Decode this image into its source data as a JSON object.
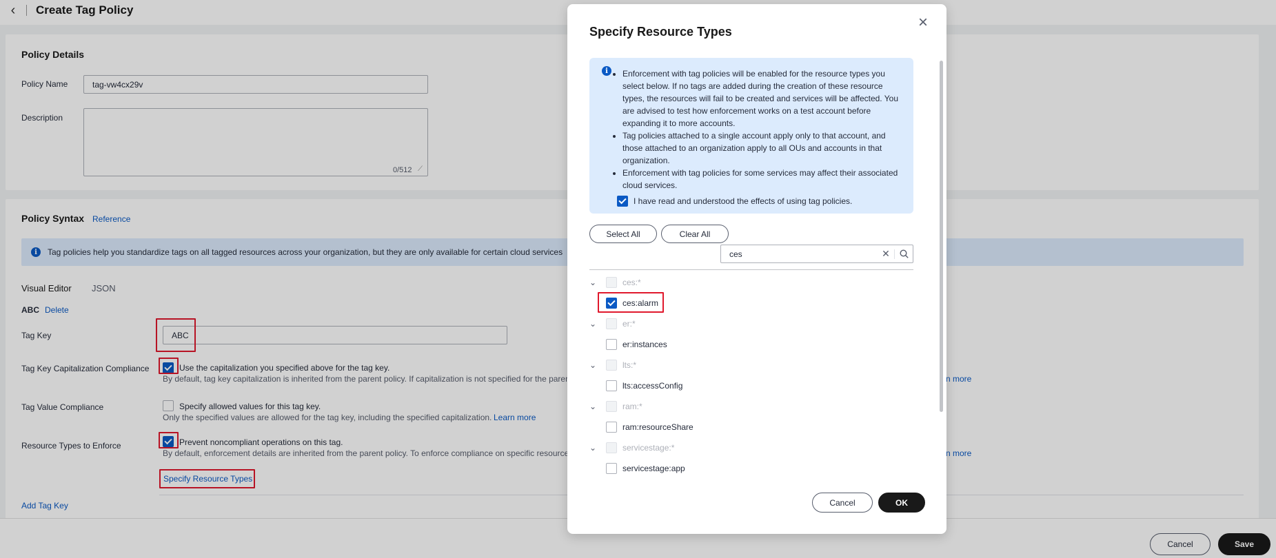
{
  "header": {
    "title": "Create Tag Policy"
  },
  "policy_details": {
    "title": "Policy Details",
    "name_label": "Policy Name",
    "name_value": "tag-vw4cx29v",
    "description_label": "Description",
    "description_counter": "0/512"
  },
  "policy_syntax": {
    "title": "Policy Syntax",
    "reference_link": "Reference",
    "info_text": "Tag policies help you standardize tags on all tagged resources across your organization, but they are only available for certain cloud services",
    "tabs": {
      "visual": "Visual Editor",
      "json": "JSON"
    },
    "tag_block_name": "ABC",
    "delete_link": "Delete",
    "tag_key_label": "Tag Key",
    "tag_key_value": "ABC",
    "cap_label": "Tag Key Capitalization Compliance",
    "cap_checkbox_text": "Use the capitalization you specified above for the tag key.",
    "cap_help": "By default, tag key capitalization is inherited from the parent policy. If capitalization is not specified for the paren",
    "cap_learn_more": "rn more",
    "value_label": "Tag Value Compliance",
    "value_checkbox_text": "Specify allowed values for this tag key.",
    "value_help": "Only the specified values are allowed for the tag key, including the specified capitalization.",
    "value_learn_more": "Learn more",
    "enforce_label": "Resource Types to Enforce",
    "enforce_checkbox_text": "Prevent noncompliant operations on this tag.",
    "enforce_help": "By default, enforcement details are inherited from the parent policy. To enforce compliance on specific resource",
    "enforce_learn_more": "rn more",
    "specify_link": "Specify Resource Types",
    "add_tag_key": "Add Tag Key"
  },
  "footer": {
    "cancel": "Cancel",
    "save": "Save"
  },
  "modal": {
    "title": "Specify Resource Types",
    "close_glyph": "×",
    "notices": [
      "Enforcement with tag policies will be enabled for the resource types you select below. If no tags are added during the creation of these resource types, the resources will fail to be created and services will be affected. You are advised to test how enforcement works on a test account before expanding it to more accounts.",
      "Tag policies attached to a single account apply only to that account, and those attached to an organization apply to all OUs and accounts in that organization.",
      "Enforcement with tag policies for some services may affect their associated cloud services."
    ],
    "ack_text": "I have read and understood the effects of using tag policies.",
    "select_all": "Select All",
    "clear_all": "Clear All",
    "search_value": "ces",
    "tree": [
      {
        "group": "ces:*",
        "child": "ces:alarm",
        "child_checked": true
      },
      {
        "group": "er:*",
        "child": "er:instances",
        "child_checked": false
      },
      {
        "group": "lts:*",
        "child": "lts:accessConfig",
        "child_checked": false
      },
      {
        "group": "ram:*",
        "child": "ram:resourceShare",
        "child_checked": false
      },
      {
        "group": "servicestage:*",
        "child": "servicestage:app",
        "child_checked": false
      }
    ],
    "cancel": "Cancel",
    "ok": "OK"
  },
  "colors": {
    "accent": "#0a59c4",
    "highlight": "#e0182c",
    "info_bg": "#dcebfd",
    "dark_button": "#191919"
  }
}
